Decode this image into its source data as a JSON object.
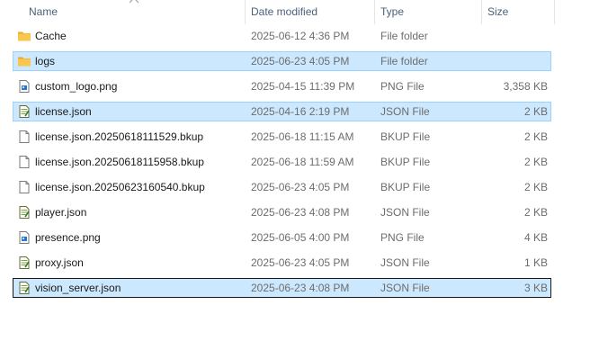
{
  "columns": {
    "name": "Name",
    "date": "Date modified",
    "type": "Type",
    "size": "Size"
  },
  "files": [
    {
      "name": "Cache",
      "date": "2025-06-12 4:36 PM",
      "type": "File folder",
      "size": "",
      "icon": "folder-icon",
      "state": "normal"
    },
    {
      "name": "logs",
      "date": "2025-06-23 4:05 PM",
      "type": "File folder",
      "size": "",
      "icon": "folder-icon",
      "state": "selected"
    },
    {
      "name": "custom_logo.png",
      "date": "2025-04-15 11:39 PM",
      "type": "PNG File",
      "size": "3,358 KB",
      "icon": "image-file-icon",
      "state": "normal"
    },
    {
      "name": "license.json",
      "date": "2025-04-16 2:19 PM",
      "type": "JSON File",
      "size": "2 KB",
      "icon": "json-file-icon",
      "state": "selected"
    },
    {
      "name": "license.json.20250618111529.bkup",
      "date": "2025-06-18 11:15 AM",
      "type": "BKUP File",
      "size": "2 KB",
      "icon": "blank-file-icon",
      "state": "normal"
    },
    {
      "name": "license.json.20250618115958.bkup",
      "date": "2025-06-18 11:59 AM",
      "type": "BKUP File",
      "size": "2 KB",
      "icon": "blank-file-icon",
      "state": "normal"
    },
    {
      "name": "license.json.20250623160540.bkup",
      "date": "2025-06-23 4:05 PM",
      "type": "BKUP File",
      "size": "2 KB",
      "icon": "blank-file-icon",
      "state": "normal"
    },
    {
      "name": "player.json",
      "date": "2025-06-23 4:08 PM",
      "type": "JSON File",
      "size": "2 KB",
      "icon": "json-file-icon",
      "state": "normal"
    },
    {
      "name": "presence.png",
      "date": "2025-06-05 4:00 PM",
      "type": "PNG File",
      "size": "4 KB",
      "icon": "image-file-icon",
      "state": "normal"
    },
    {
      "name": "proxy.json",
      "date": "2025-06-23 4:05 PM",
      "type": "JSON File",
      "size": "1 KB",
      "icon": "json-file-icon",
      "state": "normal"
    },
    {
      "name": "vision_server.json",
      "date": "2025-06-23 4:08 PM",
      "type": "JSON File",
      "size": "3 KB",
      "icon": "json-file-icon",
      "state": "focused"
    }
  ],
  "colors": {
    "selection_bg": "#cce8ff",
    "selection_border": "#99d1ff",
    "folder": "#f8c74b",
    "header_text": "#4c607a"
  }
}
